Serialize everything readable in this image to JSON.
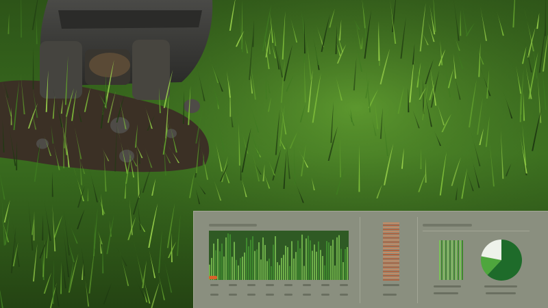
{
  "scene": {
    "subject": "boot-on-lawn-with-analytics-overlay",
    "colors": {
      "grass_dark": "#1f3a12",
      "grass_mid": "#3f7a21",
      "grass_light": "#7fbf3a",
      "soil": "#3b3025",
      "boot": "#3a3a38",
      "panel": "#8a8f7f",
      "chart_green": "#3f8a2e",
      "pie_dark": "#1e6b2a",
      "pie_mid": "#4ea63d",
      "pie_light": "#eef2ea",
      "accent_orange": "#d9622b",
      "column_rust": "#b0603d"
    }
  },
  "overlay": {
    "pie_fractions": [
      0.62,
      0.16,
      0.22
    ]
  }
}
